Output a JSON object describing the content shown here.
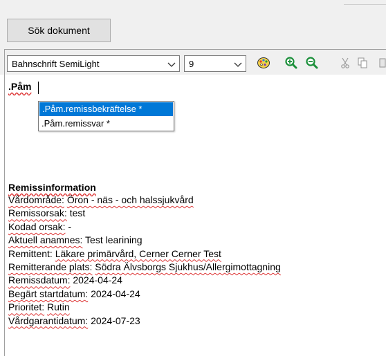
{
  "header": {
    "search_button_label": "Sök dokument"
  },
  "toolbar": {
    "font": "Bahnschrift SemiLight",
    "size": "9",
    "icons": [
      "palette-icon",
      "zoom-in-icon",
      "zoom-out-icon",
      "cut-icon",
      "copy-icon"
    ]
  },
  "editor": {
    "typed_text": ".Påm",
    "autocomplete": [
      ".Påm.remissbekräftelse *",
      ".Påm.remissvar *"
    ],
    "remiss": {
      "title": "Remissinformation",
      "rows": [
        {
          "label": "Vårdområde:",
          "value": "Öron - näs - och halssjukvård"
        },
        {
          "label": "Remissorsak:",
          "value": "test"
        },
        {
          "label": "Kodad orsak:",
          "value": "-"
        },
        {
          "label": "Aktuell anamnes:",
          "value": "Test learining"
        },
        {
          "label": "Remittent:",
          "value": "Läkare primärvård, Cerner Cerner Test"
        },
        {
          "label": "Remitterande plats:",
          "value": "Södra Älvsborgs Sjukhus/Allergimottagning"
        },
        {
          "label": "Remissdatum:",
          "value": "2024-04-24"
        },
        {
          "label": "Begärt startdatum:",
          "value": "2024-04-24"
        },
        {
          "label": "Prioritet:",
          "value": "Rutin"
        },
        {
          "label": "Vårdgarantidatum:",
          "value": "2024-07-23"
        }
      ]
    }
  }
}
